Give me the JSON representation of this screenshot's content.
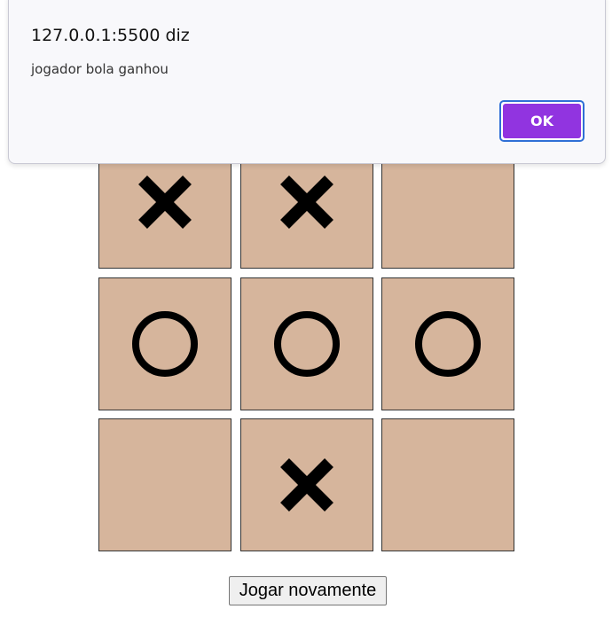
{
  "dialog": {
    "title": "127.0.0.1:5500 diz",
    "message": "jogador bola ganhou",
    "ok_label": "OK",
    "accent_color": "#9134e0"
  },
  "board": {
    "cell_color": "#d6b59c",
    "cells": [
      {
        "mark": "x-icon"
      },
      {
        "mark": "x-icon"
      },
      {
        "mark": ""
      },
      {
        "mark": "o-icon"
      },
      {
        "mark": "o-icon"
      },
      {
        "mark": "o-icon"
      },
      {
        "mark": ""
      },
      {
        "mark": "x-icon"
      },
      {
        "mark": ""
      }
    ]
  },
  "replay_button": {
    "label": "Jogar novamente"
  }
}
